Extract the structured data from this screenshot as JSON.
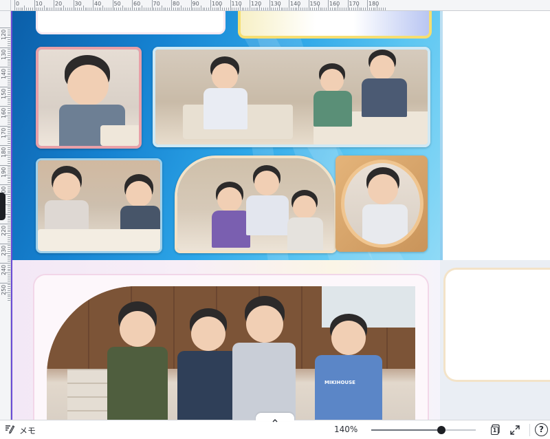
{
  "ruler": {
    "top_labels": [
      "0",
      "10",
      "20",
      "30",
      "40",
      "50",
      "60",
      "70",
      "80",
      "90",
      "100",
      "110",
      "120",
      "130",
      "140",
      "150",
      "160",
      "170",
      "180"
    ],
    "left_labels": [
      "120",
      "130",
      "140",
      "150",
      "160",
      "170",
      "180",
      "190",
      "200",
      "210",
      "220",
      "230",
      "240",
      "250"
    ]
  },
  "canvas": {
    "upper_page": {
      "photos": [
        "boy-eating-photo",
        "classroom-wide-photo",
        "girl-table-photo",
        "kids-group-photo",
        "boy-circle-photo"
      ]
    },
    "lower_page": {
      "photos": [
        "kids-singing-photo"
      ]
    },
    "shirt_text": "MIKIHOUSE"
  },
  "bottombar": {
    "memo_label": "メモ",
    "zoom_label": "140%",
    "zoom_level": 0.67,
    "page_count": "1",
    "help_label": "?"
  },
  "icons": {
    "memo": "memo-icon",
    "pages": "pages-icon",
    "fullscreen": "fullscreen-icon",
    "help": "help-icon",
    "collapse": "chevron-up-icon"
  },
  "colors": {
    "page_blue": "#1683d2",
    "page_pink": "#f3e8f6",
    "guide": "#6a4bd6",
    "ui_dark": "#1d1f24"
  }
}
